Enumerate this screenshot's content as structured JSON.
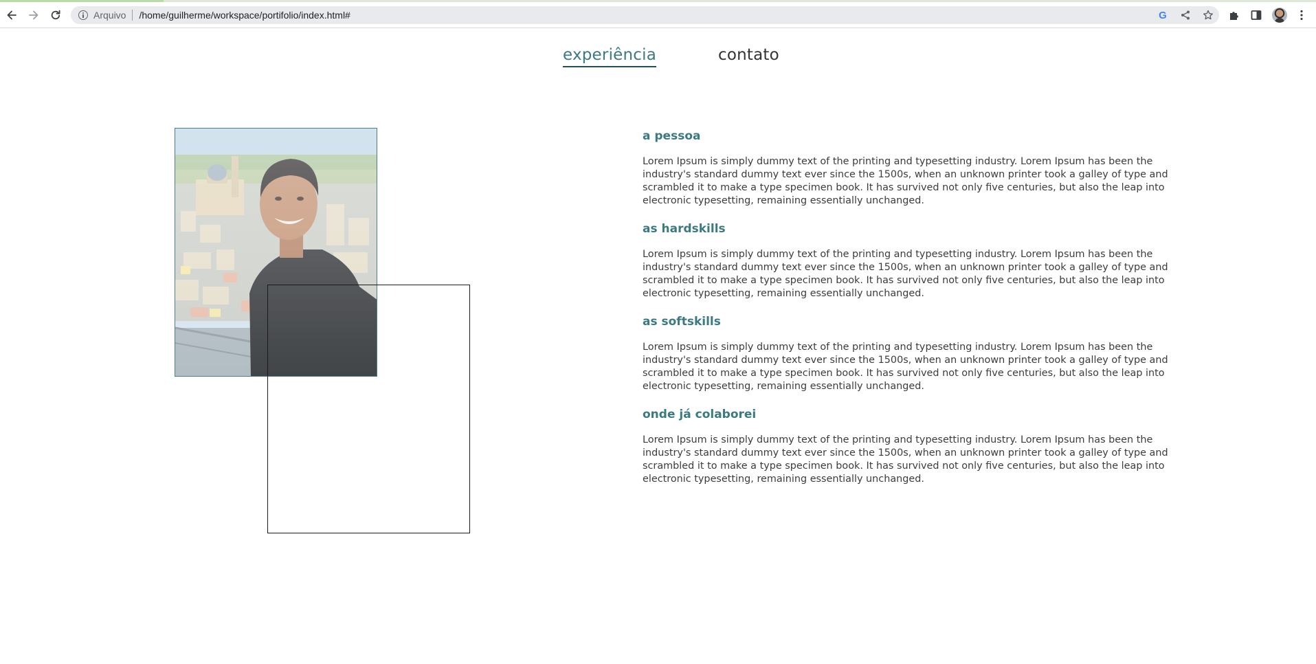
{
  "browser": {
    "address_scheme": "Arquivo",
    "url": "/home/guilherme/workspace/portifolio/index.html#",
    "icons": {
      "back": "back-arrow-icon",
      "forward": "forward-arrow-icon",
      "reload": "reload-icon",
      "site_info": "info-icon",
      "google": "google-icon",
      "share": "share-icon",
      "bookmark": "star-icon",
      "extensions": "puzzle-icon",
      "side_panel": "side-panel-icon",
      "profile": "avatar",
      "menu": "kebab-menu-icon"
    },
    "google_glyph": "G"
  },
  "nav": {
    "items": [
      {
        "label": "experiência",
        "active": true
      },
      {
        "label": "contato",
        "active": false
      }
    ]
  },
  "sections": [
    {
      "title": "a pessoa",
      "text": "Lorem Ipsum is simply dummy text of the printing and typesetting industry. Lorem Ipsum has been the industry's standard dummy text ever since the 1500s, when an unknown printer took a galley of type and scrambled it to make a type specimen book. It has survived not only five centuries, but also the leap into electronic typesetting, remaining essentially unchanged."
    },
    {
      "title": "as hardskills",
      "text": "Lorem Ipsum is simply dummy text of the printing and typesetting industry. Lorem Ipsum has been the industry's standard dummy text ever since the 1500s, when an unknown printer took a galley of type and scrambled it to make a type specimen book. It has survived not only five centuries, but also the leap into electronic typesetting, remaining essentially unchanged."
    },
    {
      "title": "as softskills",
      "text": "Lorem Ipsum is simply dummy text of the printing and typesetting industry. Lorem Ipsum has been the industry's standard dummy text ever since the 1500s, when an unknown printer took a galley of type and scrambled it to make a type specimen book. It has survived not only five centuries, but also the leap into electronic typesetting, remaining essentially unchanged."
    },
    {
      "title": "onde já colaborei",
      "text": "Lorem Ipsum is simply dummy text of the printing and typesetting industry. Lorem Ipsum has been the industry's standard dummy text ever since the 1500s, when an unknown printer took a galley of type and scrambled it to make a type specimen book. It has survived not only five centuries, but also the leap into electronic typesetting, remaining essentially unchanged."
    }
  ],
  "colors": {
    "accent": "#3a7a80",
    "accent_dark": "#1f5257",
    "body_text": "#3c3c3c",
    "nav_text": "#333333",
    "photo_border": "#4d7d86",
    "box_border": "#1b1b1b"
  }
}
